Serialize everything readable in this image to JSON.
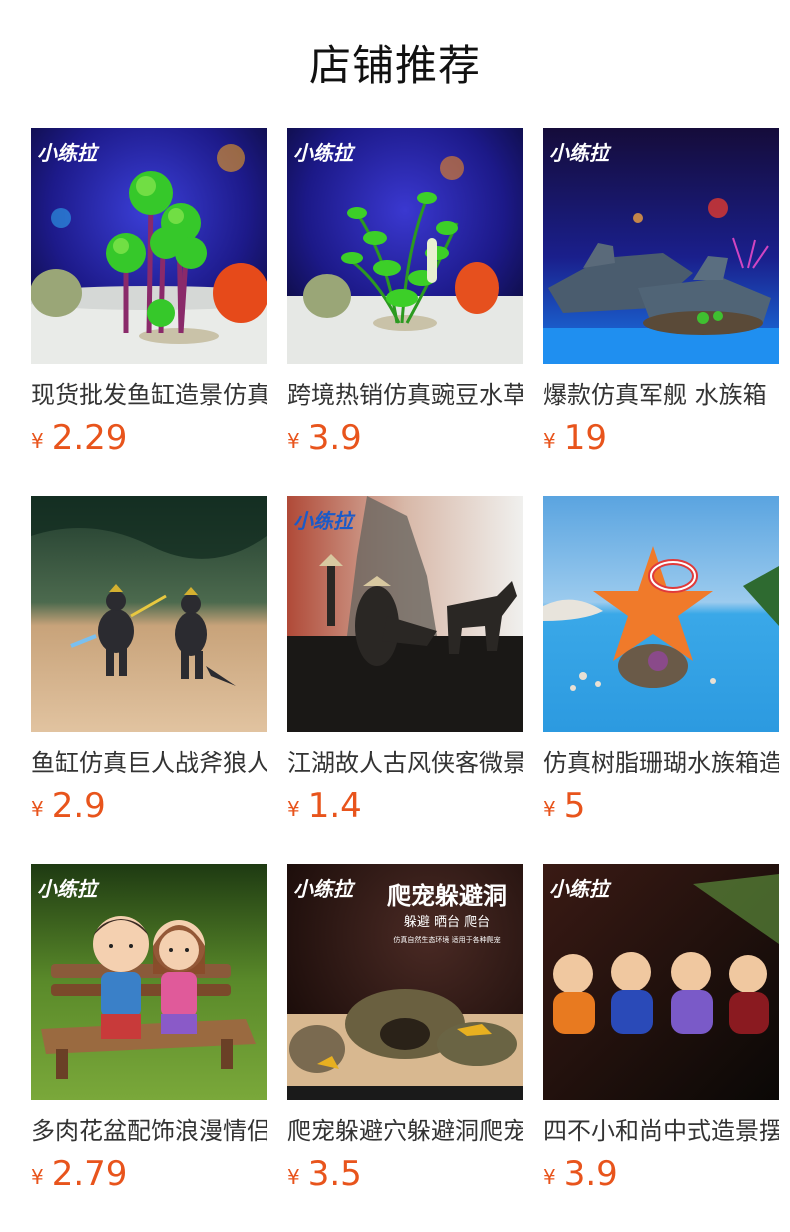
{
  "page": {
    "title": "店铺推荐"
  },
  "brand_logo_text": "小练拉",
  "colors": {
    "price": "#e8541c",
    "text": "#333333"
  },
  "products": [
    {
      "name": "现货批发鱼缸造景仿真",
      "currency": "¥",
      "price": "2.29",
      "image": "aquarium-plant-palm"
    },
    {
      "name": "跨境热销仿真豌豆水草",
      "currency": "¥",
      "price": "3.9",
      "image": "aquarium-plant-green"
    },
    {
      "name": "爆款仿真军舰 水族箱",
      "currency": "¥",
      "price": "19",
      "image": "sunken-warship"
    },
    {
      "name": "鱼缸仿真巨人战斧狼人",
      "currency": "¥",
      "price": "2.9",
      "image": "giant-warrior-figures"
    },
    {
      "name": "江湖故人古风侠客微景",
      "currency": "¥",
      "price": "1.4",
      "image": "swordsman-horse-figures"
    },
    {
      "name": "仿真树脂珊瑚水族箱造",
      "currency": "¥",
      "price": "5",
      "image": "starfish-coral"
    },
    {
      "name": "多肉花盆配饰浪漫情侣",
      "currency": "¥",
      "price": "2.79",
      "image": "couple-on-bench"
    },
    {
      "name": "爬宠躲避穴躲避洞爬宠",
      "currency": "¥",
      "price": "3.5",
      "image": "reptile-hide-cave",
      "banner": {
        "title": "爬宠躲避洞",
        "subtitle": "躲避 晒台 爬台",
        "note": "仿真自然生态环境 适用于各种爬宠"
      }
    },
    {
      "name": "四不小和尚中式造景摆",
      "currency": "¥",
      "price": "3.9",
      "image": "four-little-monks"
    }
  ]
}
